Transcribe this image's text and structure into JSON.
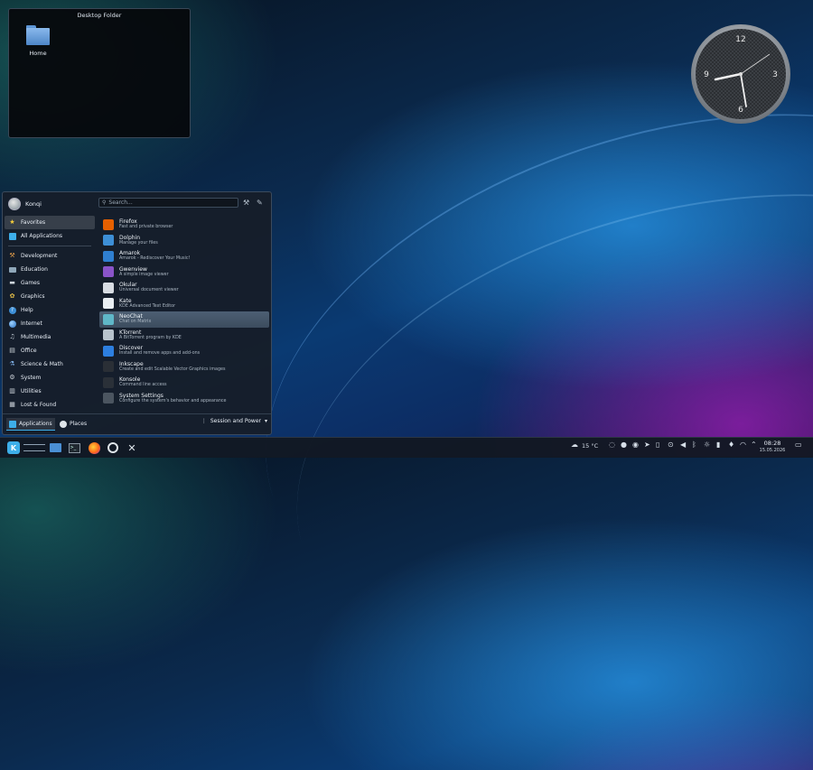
{
  "desktop_folder": {
    "title": "Desktop Folder",
    "items": [
      {
        "label": "Home"
      }
    ]
  },
  "launcher": {
    "user": "Konqi",
    "search_placeholder": "Search...",
    "categories": [
      {
        "label": "Favorites",
        "icon": "star-icon"
      },
      {
        "label": "All Applications",
        "icon": "grid-icon"
      },
      {
        "label": "Development",
        "icon": "hammer-icon"
      },
      {
        "label": "Education",
        "icon": "education-icon"
      },
      {
        "label": "Games",
        "icon": "gamepad-icon"
      },
      {
        "label": "Graphics",
        "icon": "graphics-icon"
      },
      {
        "label": "Help",
        "icon": "help-icon"
      },
      {
        "label": "Internet",
        "icon": "globe-icon"
      },
      {
        "label": "Multimedia",
        "icon": "multimedia-icon"
      },
      {
        "label": "Office",
        "icon": "office-icon"
      },
      {
        "label": "Science & Math",
        "icon": "science-icon"
      },
      {
        "label": "System",
        "icon": "system-gear-icon"
      },
      {
        "label": "Utilities",
        "icon": "utilities-icon"
      },
      {
        "label": "Lost & Found",
        "icon": "lost-found-icon"
      }
    ],
    "apps": [
      {
        "name": "Firefox",
        "desc": "Fast and private browser",
        "icon": "firefox-icon",
        "color": "#e66000"
      },
      {
        "name": "Dolphin",
        "desc": "Manage your files",
        "icon": "dolphin-icon",
        "color": "#3d8fd6"
      },
      {
        "name": "Amarok",
        "desc": "Amarok - Rediscover Your Music!",
        "icon": "amarok-icon",
        "color": "#2f7fd0"
      },
      {
        "name": "Gwenview",
        "desc": "A simple image viewer",
        "icon": "gwenview-icon",
        "color": "#8a54c8"
      },
      {
        "name": "Okular",
        "desc": "Universal document viewer",
        "icon": "okular-icon",
        "color": "#d8dde3"
      },
      {
        "name": "Kate",
        "desc": "KDE Advanced Text Editor",
        "icon": "kate-icon",
        "color": "#e9eef2"
      },
      {
        "name": "NeoChat",
        "desc": "Chat on Matrix",
        "icon": "neochat-icon",
        "color": "#5fb7c8"
      },
      {
        "name": "KTorrent",
        "desc": "A BitTorrent program by KDE",
        "icon": "ktorrent-icon",
        "color": "#b8c3cc"
      },
      {
        "name": "Discover",
        "desc": "Install and remove apps and add-ons",
        "icon": "discover-icon",
        "color": "#2d7fe0"
      },
      {
        "name": "Inkscape",
        "desc": "Create and edit Scalable Vector Graphics images",
        "icon": "inkscape-icon",
        "color": "#2a2f36"
      },
      {
        "name": "Konsole",
        "desc": "Command line access",
        "icon": "konsole-icon",
        "color": "#2a3038"
      },
      {
        "name": "System Settings",
        "desc": "Configure the system's behavior and appearance",
        "icon": "system-settings-icon",
        "color": "#4b5560"
      }
    ],
    "footer": {
      "applications": "Applications",
      "places": "Places",
      "session": "Session and Power"
    }
  },
  "taskbar": {
    "weather": "15 °C",
    "time": "08:28",
    "date": "15.05.2026"
  },
  "clock_widget": {
    "numbers": [
      "12",
      "3",
      "6",
      "9"
    ]
  }
}
